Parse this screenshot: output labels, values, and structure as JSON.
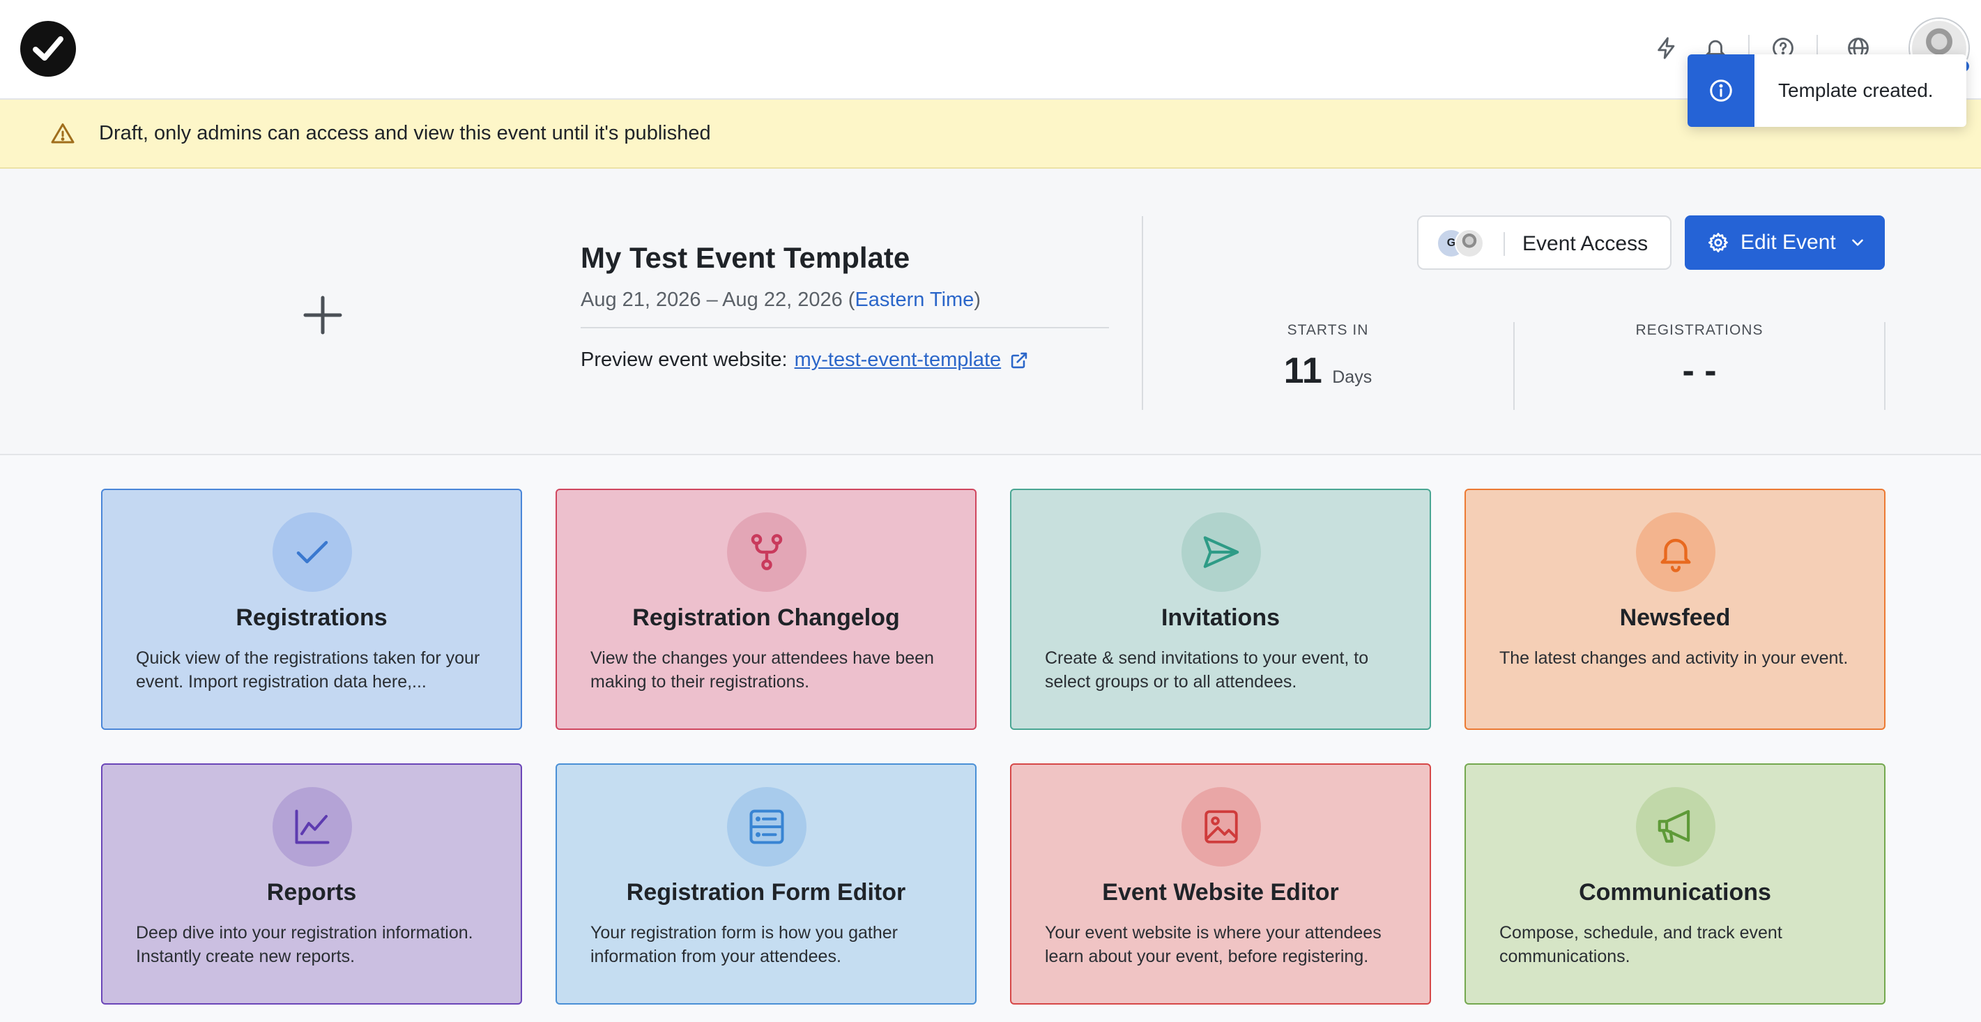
{
  "toast": {
    "message": "Template created."
  },
  "banner": {
    "text": "Draft, only admins can access and view this event until it's published"
  },
  "event": {
    "title": "My Test Event Template",
    "date_range": "Aug 21, 2026 – Aug 22, 2026 (",
    "timezone": "Eastern Time",
    "date_close": ")",
    "preview_label": "Preview event website:",
    "preview_link": "my-test-event-template"
  },
  "access": {
    "label": "Event Access",
    "avatar_initial": "G"
  },
  "edit": {
    "label": "Edit Event"
  },
  "stats": {
    "starts_in_label": "STARTS IN",
    "starts_in_value": "11",
    "starts_in_unit": "Days",
    "registrations_label": "REGISTRATIONS",
    "registrations_value": "- -"
  },
  "cards": [
    {
      "title": "Registrations",
      "desc": "Quick view of the registrations taken for your event. Import registration data here,...",
      "bg": "#c4d8f2",
      "border": "#4a86d8",
      "circle": "#a9c6ef",
      "icon_color": "#3a78cf",
      "icon": "check-icon"
    },
    {
      "title": "Registration Changelog",
      "desc": "View the changes your attendees have been making to their registrations.",
      "bg": "#edc0cd",
      "border": "#d0475f",
      "circle": "#e3a6b6",
      "icon_color": "#c93a5c",
      "icon": "branch-icon"
    },
    {
      "title": "Invitations",
      "desc": "Create & send invitations to your event, to select groups or to all attendees.",
      "bg": "#c8e0dd",
      "border": "#4aa693",
      "circle": "#b0d3cc",
      "icon_color": "#2e9b86",
      "icon": "send-icon"
    },
    {
      "title": "Newsfeed",
      "desc": "The latest changes and activity in your event.",
      "bg": "#f5cfb6",
      "border": "#ec7a33",
      "circle": "#f3b48e",
      "icon_color": "#e8691f",
      "icon": "bell-icon"
    },
    {
      "title": "Reports",
      "desc": "Deep dive into your registration information. Instantly create new reports.",
      "bg": "#cbbfe1",
      "border": "#6b46b8",
      "circle": "#b4a3d6",
      "icon_color": "#5d3bb0",
      "icon": "chart-icon"
    },
    {
      "title": "Registration Form Editor",
      "desc": "Your registration form is how you gather information from your attendees.",
      "bg": "#c5ddf1",
      "border": "#4a90d6",
      "circle": "#a8cbec",
      "icon_color": "#3884d3",
      "icon": "form-icon"
    },
    {
      "title": "Event Website Editor",
      "desc": "Your event website is where your attendees learn about your event, before registering.",
      "bg": "#f0c4c4",
      "border": "#d64848",
      "circle": "#e9a6a6",
      "icon_color": "#cf3b3b",
      "icon": "image-icon"
    },
    {
      "title": "Communications",
      "desc": "Compose, schedule, and track event communications.",
      "bg": "#d6e5c6",
      "border": "#74a84f",
      "circle": "#c1d8a9",
      "icon_color": "#5e9a38",
      "icon": "megaphone-icon"
    }
  ]
}
